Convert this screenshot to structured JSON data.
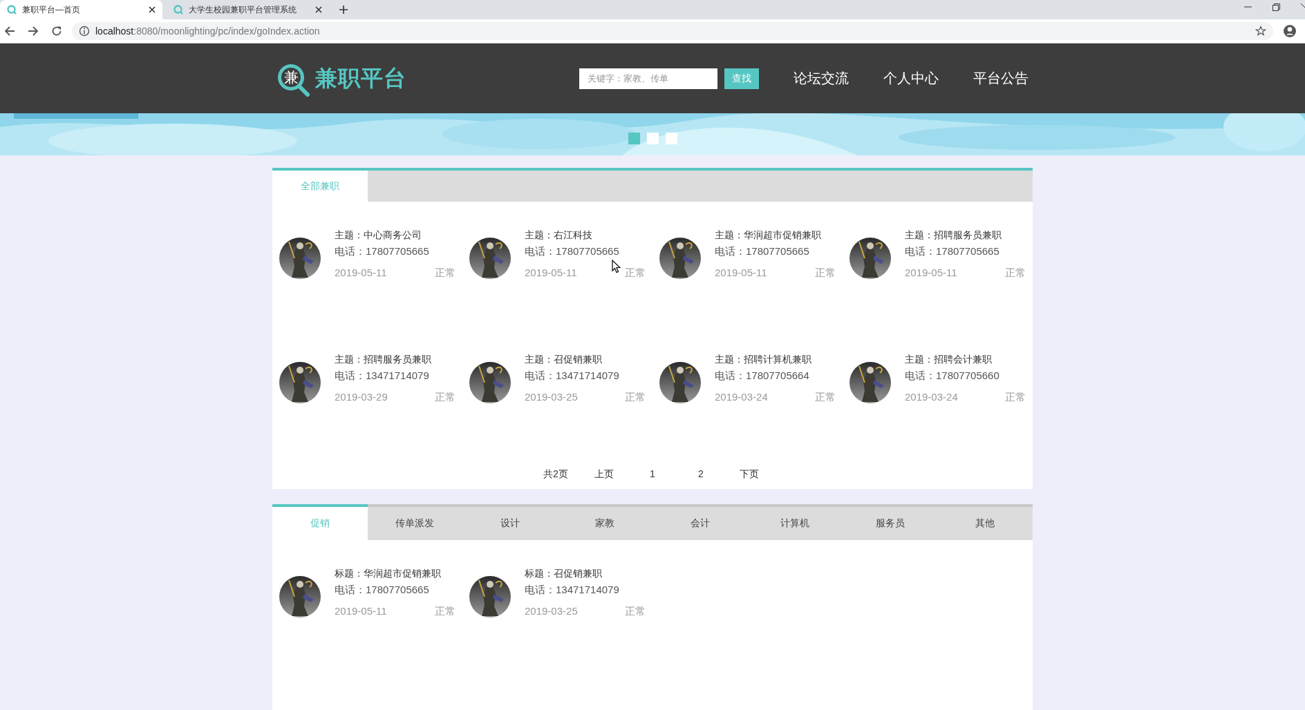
{
  "browser": {
    "tabs": [
      {
        "title": "兼职平台—首页",
        "selected": true
      },
      {
        "title": "大学生校园兼职平台管理系统",
        "selected": false
      }
    ],
    "url": {
      "host": "localhost",
      "path": ":8080/moonlighting/pc/index/goIndex.action"
    }
  },
  "header": {
    "logo_mark": "兼",
    "logo_text": "兼职平台",
    "search": {
      "placeholder": "关键字：家教、传单"
    },
    "search_button": "查找",
    "nav": [
      "论坛交流",
      "个人中心",
      "平台公告"
    ]
  },
  "banner": {
    "dots": [
      {
        "selected": true
      },
      {
        "selected": false
      },
      {
        "selected": false
      }
    ]
  },
  "all_jobs": {
    "tabs": [
      {
        "label": "全部兼职",
        "selected": true
      }
    ],
    "cards": [
      {
        "subject": "主题：中心商务公司",
        "phone": "电话：17807705665",
        "date": "2019-05-11",
        "status": "正常"
      },
      {
        "subject": "主题：右江科技",
        "phone": "电话：17807705665",
        "date": "2019-05-11",
        "status": "正常"
      },
      {
        "subject": "主题：华润超市促销兼职",
        "phone": "电话：17807705665",
        "date": "2019-05-11",
        "status": "正常"
      },
      {
        "subject": "主题：招聘服务员兼职",
        "phone": "电话：17807705665",
        "date": "2019-05-11",
        "status": "正常"
      },
      {
        "subject": "主题：招聘服务员兼职",
        "phone": "电话：13471714079",
        "date": "2019-03-29",
        "status": "正常"
      },
      {
        "subject": "主题：召促销兼职",
        "phone": "电话：13471714079",
        "date": "2019-03-25",
        "status": "正常"
      },
      {
        "subject": "主题：招聘计算机兼职",
        "phone": "电话：17807705664",
        "date": "2019-03-24",
        "status": "正常"
      },
      {
        "subject": "主题：招聘会计兼职",
        "phone": "电话：17807705660",
        "date": "2019-03-24",
        "status": "正常"
      }
    ],
    "pagination": {
      "total": "共2页",
      "prev": "上页",
      "pages": [
        "1",
        "2"
      ],
      "next": "下页"
    }
  },
  "category_jobs": {
    "tabs": [
      {
        "label": "促销",
        "selected": true
      },
      {
        "label": "传单派发",
        "selected": false
      },
      {
        "label": "设计",
        "selected": false
      },
      {
        "label": "家教",
        "selected": false
      },
      {
        "label": "会计",
        "selected": false
      },
      {
        "label": "计算机",
        "selected": false
      },
      {
        "label": "服务员",
        "selected": false
      },
      {
        "label": "其他",
        "selected": false
      }
    ],
    "cards": [
      {
        "subject": "标题：华润超市促销兼职",
        "phone": "电话：17807705665",
        "date": "2019-05-11",
        "status": "正常"
      },
      {
        "subject": "标题：召促销兼职",
        "phone": "电话：13471714079",
        "date": "2019-03-25",
        "status": "正常"
      }
    ]
  }
}
